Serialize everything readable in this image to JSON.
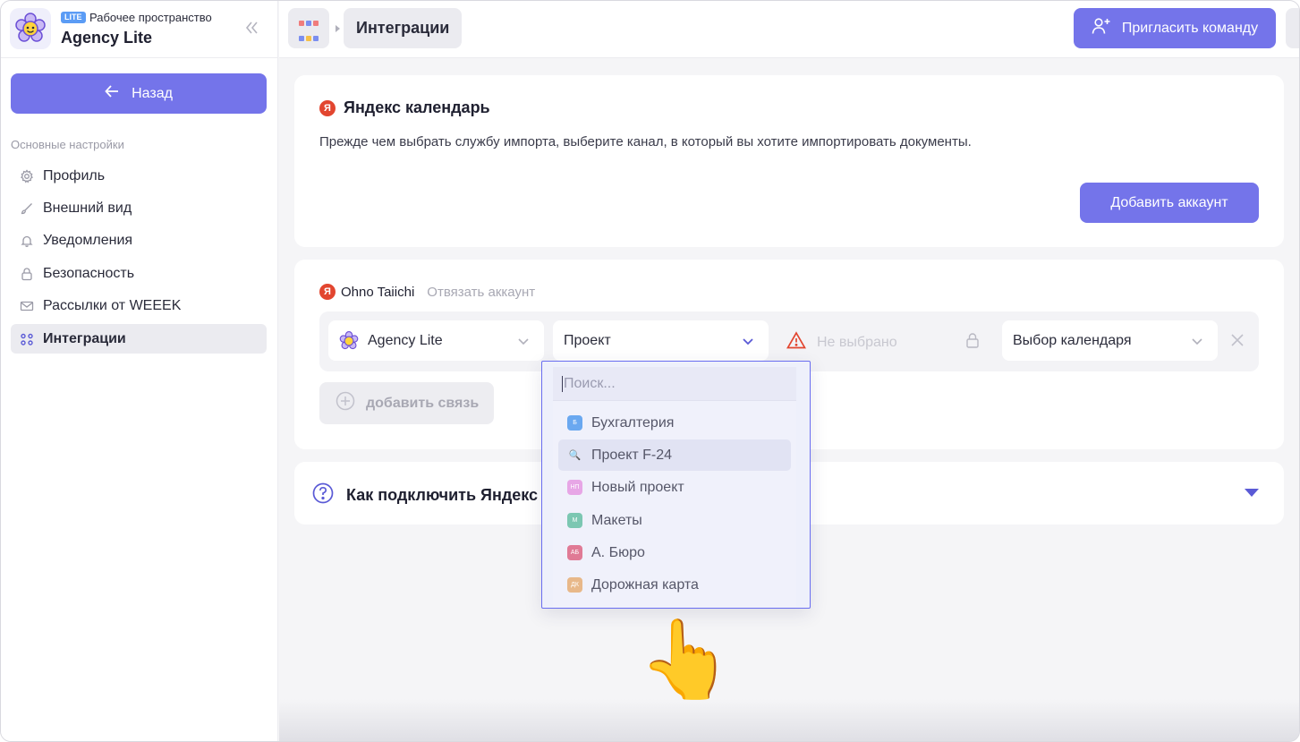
{
  "workspace": {
    "badge": "LITE",
    "subtitle": "Рабочее пространство",
    "name": "Agency Lite"
  },
  "sidebar": {
    "back_label": "Назад",
    "section_label": "Основные настройки",
    "items": [
      {
        "label": "Профиль",
        "icon": "gear-icon"
      },
      {
        "label": "Внешний вид",
        "icon": "brush-icon"
      },
      {
        "label": "Уведомления",
        "icon": "bell-icon"
      },
      {
        "label": "Безопасность",
        "icon": "lock-icon"
      },
      {
        "label": "Рассылки от WEEEK",
        "icon": "mail-icon"
      },
      {
        "label": "Интеграции",
        "icon": "integrations-icon",
        "active": true
      }
    ]
  },
  "topbar": {
    "breadcrumb": "Интеграции",
    "invite_label": "Пригласить команду"
  },
  "yandex_card": {
    "title": "Яндекс календарь",
    "badge_letter": "Я",
    "description": "Прежде чем выбрать службу импорта, выберите канал, в который вы хотите импортировать документы.",
    "add_account_label": "Добавить аккаунт"
  },
  "account_card": {
    "badge_letter": "Я",
    "account_name": "Ohno Taiichi",
    "unlink_label": "Отвязать аккаунт",
    "workspace_select": "Agency Lite",
    "project_select": "Проект",
    "status_text": "Не выбрано",
    "calendar_select": "Выбор календаря",
    "add_link_label": "добавить связь"
  },
  "faq": {
    "question": "Как подключить Яндекс I"
  },
  "dropdown": {
    "search_placeholder": "Поиск...",
    "items": [
      {
        "label": "Бухгалтерия",
        "badge": "Б",
        "color": "#6aa8f0"
      },
      {
        "label": "Проект F-24",
        "badge": "🔍",
        "color": "#d8dcf0",
        "hover": true
      },
      {
        "label": "Новый проект",
        "badge": "НП",
        "color": "#e7a6e6"
      },
      {
        "label": "Макеты",
        "badge": "М",
        "color": "#7cc7b2"
      },
      {
        "label": "А. Бюро",
        "badge": "АБ",
        "color": "#e07a95"
      },
      {
        "label": "Дорожная карта",
        "badge": "ДК",
        "color": "#e8b889"
      }
    ]
  },
  "colors": {
    "accent": "#7474ea",
    "yandex_red": "#e2452f",
    "warning": "#e2452f"
  }
}
